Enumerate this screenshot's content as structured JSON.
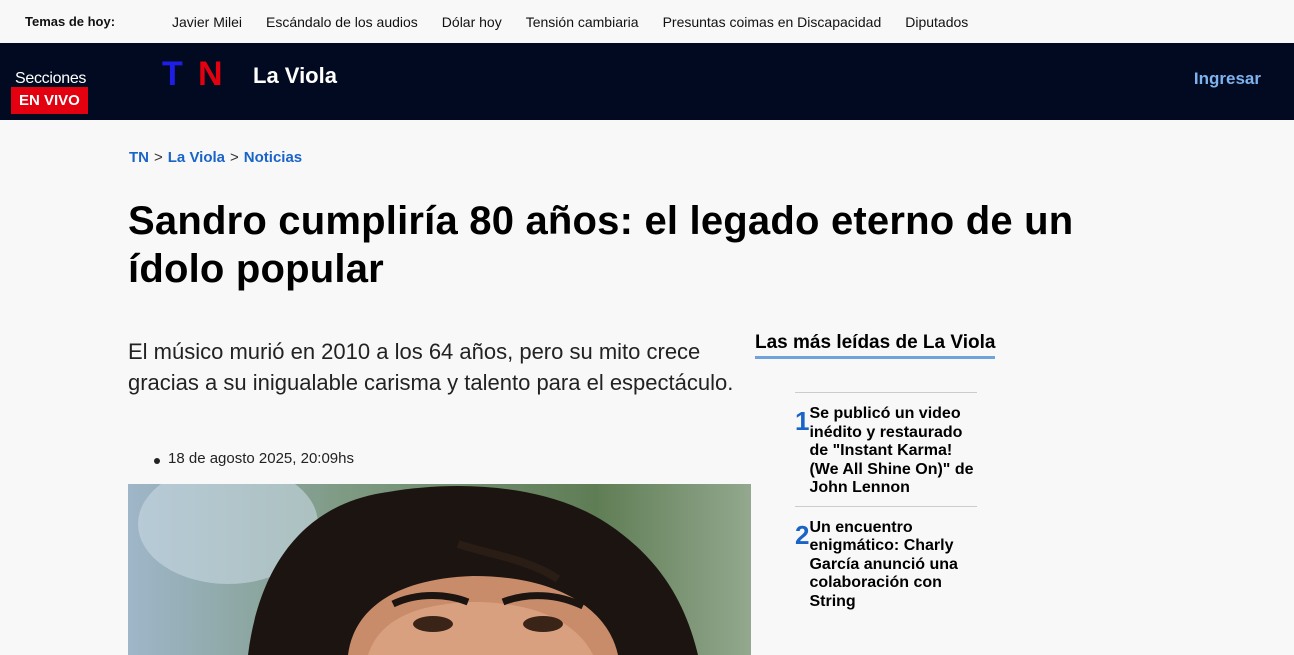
{
  "topics": {
    "label": "Temas de hoy:",
    "items": [
      "Javier Milei",
      "Escándalo de los audios",
      "Dólar hoy",
      "Tensión cambiaria",
      "Presuntas coimas en Discapacidad",
      "Diputados"
    ]
  },
  "header": {
    "sections_label": "Secciones",
    "live_label": "EN VIVO",
    "logo_letters": [
      "T",
      "N"
    ],
    "brand": "La Viola",
    "login_label": "Ingresar"
  },
  "breadcrumb": [
    "TN",
    "La Viola",
    "Noticias"
  ],
  "article": {
    "title": "Sandro cumpliría 80 años: el legado eterno de un ídolo popular",
    "lead": "El músico murió en 2010 a los 64 años, pero su mito crece gracias a su inigualable carisma y talento para el espectáculo.",
    "date": "18 de agosto 2025, 20:09hs"
  },
  "sidebar": {
    "title": "Las más leídas de La Viola",
    "items": [
      {
        "rank": "1",
        "text": "Se publicó un video inédito y restaurado de \"Instant Karma! (We All Shine On)\" de John Lennon"
      },
      {
        "rank": "2",
        "text": "Un encuentro enigmático: Charly García anunció una colaboración con String"
      }
    ]
  },
  "colors": {
    "header_bg": "#010a21",
    "live_red": "#e3000f",
    "link_blue": "#1a64c8",
    "logo_blue": "#1e1ee6",
    "logo_red": "#e3000f"
  }
}
